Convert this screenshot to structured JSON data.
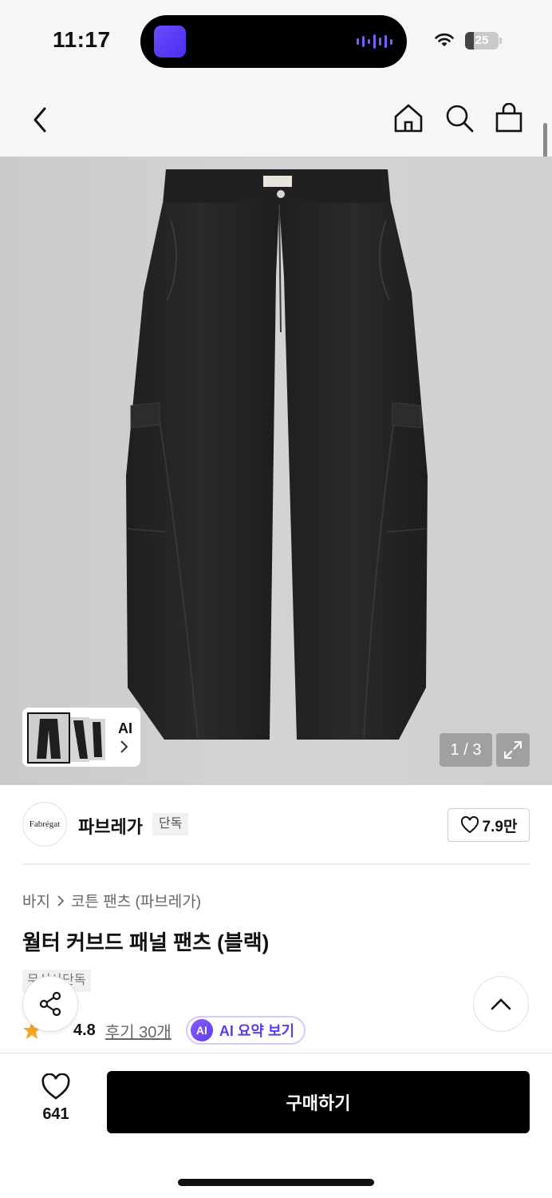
{
  "status_bar": {
    "time": "11:17",
    "battery": "25",
    "battery_level": 0.25
  },
  "nav": {
    "icons": [
      "back-icon",
      "home-icon",
      "search-icon",
      "bag-icon"
    ]
  },
  "gallery": {
    "thumb_label": "AI",
    "page_counter": "1 / 3",
    "background_color": "#cfcfd1",
    "product_color": "#232325"
  },
  "brand": {
    "logo_text": "Fabrégat",
    "name": "파브레가",
    "badge": "단독",
    "likes": "7.9만"
  },
  "product": {
    "breadcrumb": [
      "바지",
      "코튼 팬츠 (파브레가)"
    ],
    "title": "월터 커브드 패널 팬츠 (블랙)",
    "tag": "무신사단독",
    "rating": "4.8",
    "reviews": "후기 30개",
    "ai_badge": "AI",
    "ai_summary": "AI 요약 보기"
  },
  "bottom_bar": {
    "wish_count": "641",
    "buy_label": "구매하기"
  },
  "colors": {
    "accent_purple": "#5a3df0",
    "star": "#f5a623",
    "button_black": "#000000"
  }
}
